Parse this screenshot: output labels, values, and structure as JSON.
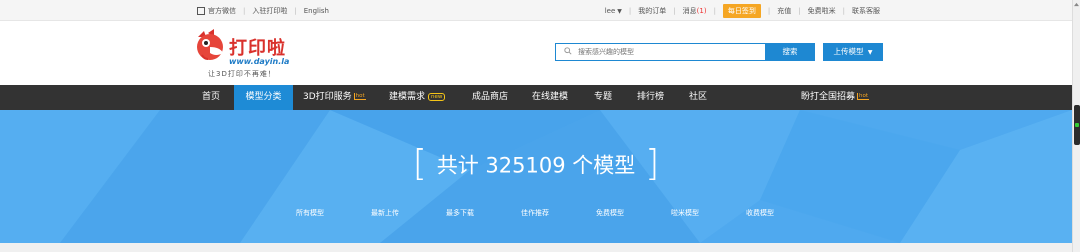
{
  "topbar": {
    "wechat": "官方微信",
    "join": "入驻打印啦",
    "english": "English",
    "user": "lee",
    "my_orders": "我的订单",
    "messages": "消息",
    "messages_count": "(1)",
    "signin": "每日签到",
    "recharge": "充值",
    "free_coins": "免费啦米",
    "support": "联系客服"
  },
  "logo": {
    "title": "打印啦",
    "url": "www.dayin.la",
    "slogan": "让3D打印不再难！"
  },
  "search": {
    "placeholder": "搜索感兴趣的模型",
    "button": "搜索",
    "upload": "上传模型"
  },
  "nav": {
    "items": [
      {
        "label": "首页"
      },
      {
        "label": "模型分类"
      },
      {
        "label": "3D打印服务",
        "tag": "hot"
      },
      {
        "label": "建模需求",
        "tag": "new"
      },
      {
        "label": "成品商店"
      },
      {
        "label": "在线建模"
      },
      {
        "label": "专题"
      },
      {
        "label": "排行榜"
      },
      {
        "label": "社区"
      },
      {
        "label": "盼打全国招募",
        "tag": "hot"
      }
    ]
  },
  "banner": {
    "count_text": "共计 325109 个模型",
    "left_bracket": "[",
    "right_bracket": "]",
    "categories": [
      "所有模型",
      "最新上传",
      "最多下载",
      "佳作推荐",
      "免费模型",
      "啦米模型",
      "收费模型"
    ]
  },
  "colors": {
    "accent": "#1e88d2",
    "nav_bg": "#333333",
    "banner_bg": "#4fa9ef",
    "signin": "#f5a623",
    "logo_red": "#d9312c"
  }
}
